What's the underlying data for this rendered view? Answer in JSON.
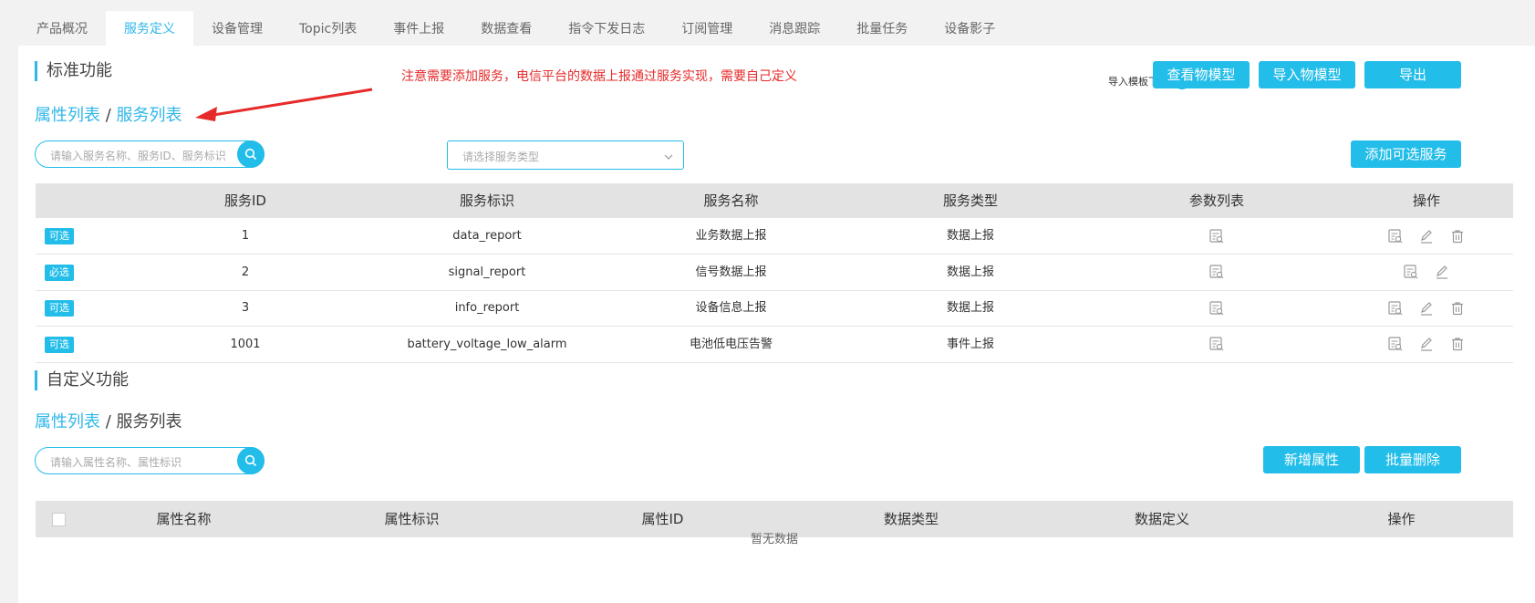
{
  "tabs": [
    "产品概况",
    "服务定义",
    "设备管理",
    "Topic列表",
    "事件上报",
    "数据查看",
    "指令下发日志",
    "订阅管理",
    "消息跟踪",
    "批量任务",
    "设备影子"
  ],
  "standard": {
    "title": "标准功能",
    "note": "注意需要添加服务，电信平台的数据上报通过服务实现，需要自己定义",
    "link_attr": "属性列表",
    "sep": "/",
    "link_service": "服务列表",
    "download_label": "导入模板下载",
    "btn_view_model": "查看物模型",
    "btn_import_model": "导入物模型",
    "btn_export": "导出",
    "search_placeholder": "请输入服务名称、服务ID、服务标识",
    "select_placeholder": "请选择服务类型",
    "btn_add_service": "添加可选服务",
    "columns": [
      "服务ID",
      "服务标识",
      "服务名称",
      "服务类型",
      "参数列表",
      "操作"
    ],
    "rows": [
      {
        "tag": "可选",
        "id": "1",
        "key": "data_report",
        "name": "业务数据上报",
        "type": "数据上报",
        "deletable": true
      },
      {
        "tag": "必选",
        "id": "2",
        "key": "signal_report",
        "name": "信号数据上报",
        "type": "数据上报",
        "deletable": false
      },
      {
        "tag": "可选",
        "id": "3",
        "key": "info_report",
        "name": "设备信息上报",
        "type": "数据上报",
        "deletable": true
      },
      {
        "tag": "可选",
        "id": "1001",
        "key": "battery_voltage_low_alarm",
        "name": "电池低电压告警",
        "type": "事件上报",
        "deletable": true
      }
    ]
  },
  "custom": {
    "title": "自定义功能",
    "link_attr": "属性列表",
    "sep": "/",
    "link_service": "服务列表",
    "search_placeholder": "请输入属性名称、属性标识",
    "btn_add_attr": "新增属性",
    "btn_batch_delete": "批量删除",
    "columns": [
      "属性名称",
      "属性标识",
      "属性ID",
      "数据类型",
      "数据定义",
      "操作"
    ],
    "empty_text": "暂无数据"
  },
  "colors": {
    "accent": "#22bde9",
    "note": "#e62a2a",
    "arrow": "#e62a2a"
  }
}
